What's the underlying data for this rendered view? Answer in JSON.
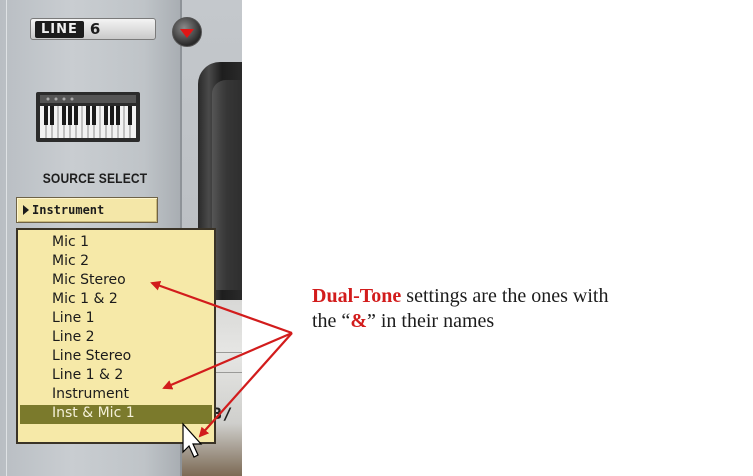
{
  "app": {
    "logo_word": "LINE",
    "logo_number": "6"
  },
  "source_select": {
    "label": "SOURCE SELECT",
    "current_value": "Instrument",
    "options": [
      "Mic 1",
      "Mic 2",
      "Mic Stereo",
      "Mic 1 & 2",
      "Line 1",
      "Line 2",
      "Line Stereo",
      "Line 1 & 2",
      "Instrument",
      "Inst & Mic 1"
    ],
    "highlighted_option": "Inst & Mic 1"
  },
  "background": {
    "partial_label": "B/"
  },
  "annotation": {
    "bold_term": "Dual-Tone",
    "line1_rest": " settings are the ones with",
    "line2_prefix": "the “",
    "symbol": "&",
    "line2_suffix": "” in their names"
  },
  "colors": {
    "dropdown_bg": "#f6e9a8",
    "highlight_bg": "#7b7a2c",
    "annotation_accent": "#d21c1c",
    "menu_arrow": "#e01616"
  }
}
